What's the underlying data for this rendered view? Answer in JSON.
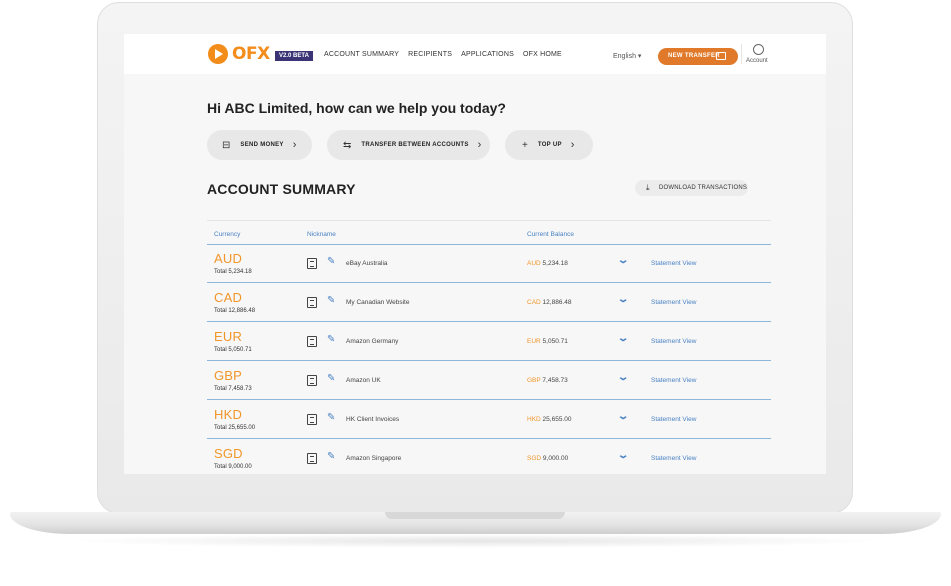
{
  "nav": {
    "logo_text": "OFX",
    "beta_label": "V2.0 BETA",
    "links": [
      "ACCOUNT SUMMARY",
      "RECIPIENTS",
      "APPLICATIONS",
      "OFX HOME"
    ],
    "language": "English ▾",
    "new_transfer_label": "NEW TRANSFER",
    "account_label": "Account"
  },
  "greeting": "Hi ABC Limited, how can we help you today?",
  "actions": [
    {
      "label": "SEND MONEY",
      "icon": "money-icon"
    },
    {
      "label": "TRANSFER BETWEEN ACCOUNTS",
      "icon": "transfer-arrows-icon"
    },
    {
      "label": "TOP UP",
      "icon": "plus-icon"
    }
  ],
  "summary": {
    "title": "ACCOUNT SUMMARY",
    "download_label": "DOWNLOAD TRANSACTIONS",
    "headers": {
      "currency": "Currency",
      "nickname": "Nickname",
      "balance": "Current Balance"
    },
    "rows": [
      {
        "currency": "AUD",
        "total": "Total 5,234.18",
        "nickname": "eBay Australia",
        "bal_code": "AUD",
        "bal_amount": "5,234.18",
        "link": "Statement View"
      },
      {
        "currency": "CAD",
        "total": "Total 12,886.48",
        "nickname": "My Canadian Website",
        "bal_code": "CAD",
        "bal_amount": "12,886.48",
        "link": "Statement View"
      },
      {
        "currency": "EUR",
        "total": "Total 5,050.71",
        "nickname": "Amazon Germany",
        "bal_code": "EUR",
        "bal_amount": "5,050.71",
        "link": "Statement View"
      },
      {
        "currency": "GBP",
        "total": "Total 7,458.73",
        "nickname": "Amazon UK",
        "bal_code": "GBP",
        "bal_amount": "7,458.73",
        "link": "Statement View"
      },
      {
        "currency": "HKD",
        "total": "Total 25,655.00",
        "nickname": "HK Client Invoices",
        "bal_code": "HKD",
        "bal_amount": "25,655.00",
        "link": "Statement View"
      },
      {
        "currency": "SGD",
        "total": "Total 9,000.00",
        "nickname": "Amazon Singapore",
        "bal_code": "SGD",
        "bal_amount": "9,000.00",
        "link": "Statement View"
      }
    ]
  },
  "colors": {
    "brand_orange": "#f28c1b",
    "link_blue": "#4a82c3",
    "beta_purple": "#3a3476"
  }
}
